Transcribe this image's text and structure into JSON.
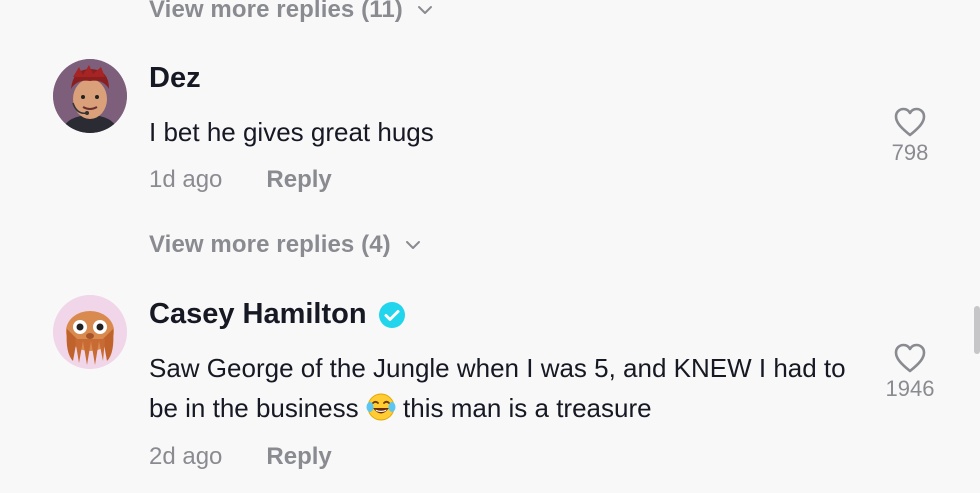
{
  "thread1": {
    "view_more": "View more replies (11)"
  },
  "comment1": {
    "username": "Dez",
    "text": "I bet he gives great hugs",
    "time": "1d ago",
    "reply_label": "Reply",
    "likes": "798",
    "view_more": "View more replies (4)"
  },
  "comment2": {
    "username": "Casey Hamilton",
    "verified": true,
    "text_before_emoji": "Saw George of the Jungle when I was 5, and KNEW I had to be in the business ",
    "emoji": "face-with-tears-of-joy",
    "text_after_emoji": " this man is a treasure",
    "time": "2d ago",
    "reply_label": "Reply",
    "likes": "1946"
  },
  "colors": {
    "text_primary": "#161823",
    "text_secondary": "#8a8b91",
    "verified_badge": "#20d5ec",
    "background": "#f8f8f8"
  }
}
